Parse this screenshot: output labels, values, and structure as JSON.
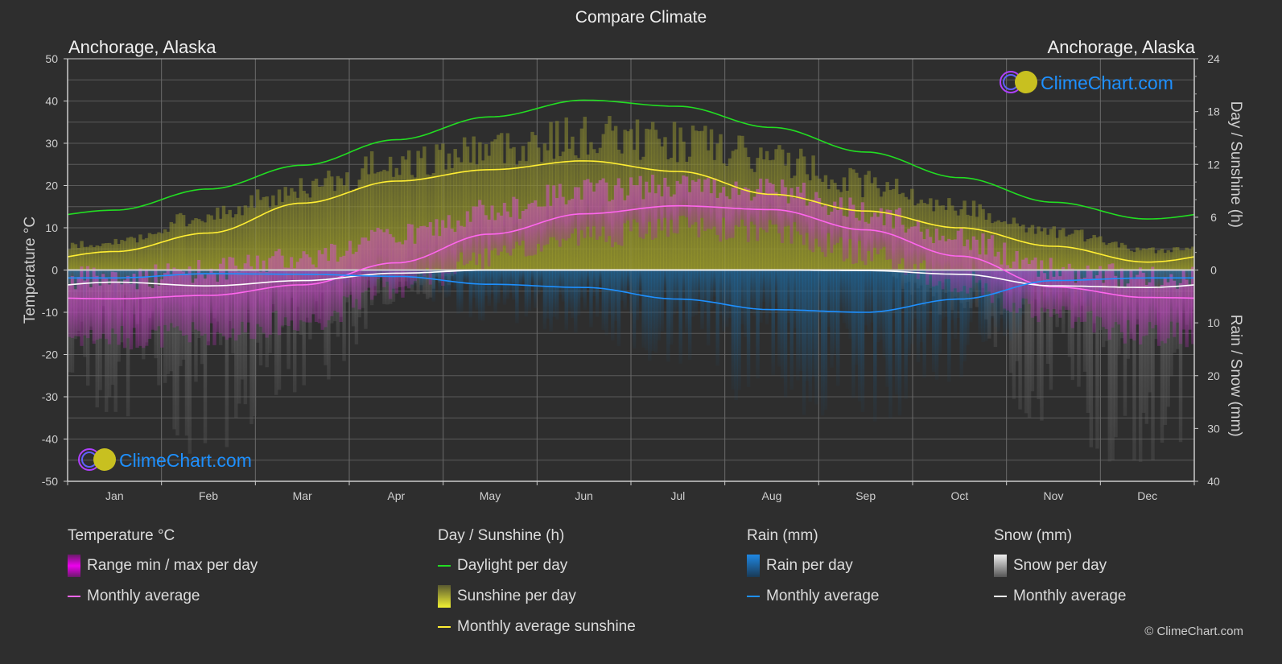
{
  "header": {
    "title": "Compare Climate",
    "location_left": "Anchorage, Alaska",
    "location_right": "Anchorage, Alaska"
  },
  "watermark": {
    "text": "ClimeChart.com"
  },
  "copyright": "© ClimeChart.com",
  "colors": {
    "background": "#2e2e2e",
    "grid": "#5a5a5a",
    "daylight": "#22dd22",
    "sunshine_fill": "#9a9a2a",
    "sunshine_avg": "#ffee33",
    "temp_range": "#cc44cc",
    "temp_avg": "#ff66ee",
    "rain_fill": "#1f5f8f",
    "rain_avg": "#1e90ff",
    "snow_fill": "#888888",
    "snow_avg": "#ffffff",
    "watermark_text": "#1e90ff"
  },
  "legend": {
    "groups": [
      {
        "title": "Temperature °C",
        "items": [
          {
            "label": "Range min / max per day",
            "kind": "bar",
            "color": "#ee00ee"
          },
          {
            "label": "Monthly average",
            "kind": "line",
            "color": "#ff66ee"
          }
        ]
      },
      {
        "title": "Day / Sunshine (h)",
        "items": [
          {
            "label": "Daylight per day",
            "kind": "line",
            "color": "#22dd22"
          },
          {
            "label": "Sunshine per day",
            "kind": "bar",
            "color": "#e6e633"
          },
          {
            "label": "Monthly average sunshine",
            "kind": "line",
            "color": "#ffee33"
          }
        ]
      },
      {
        "title": "Rain (mm)",
        "items": [
          {
            "label": "Rain per day",
            "kind": "bar",
            "color": "#1e88e5"
          },
          {
            "label": "Monthly average",
            "kind": "line",
            "color": "#1e90ff"
          }
        ]
      },
      {
        "title": "Snow (mm)",
        "items": [
          {
            "label": "Snow per day",
            "kind": "bar",
            "color": "#dddddd"
          },
          {
            "label": "Monthly average",
            "kind": "line",
            "color": "#ffffff"
          }
        ]
      }
    ]
  },
  "chart_data": {
    "type": "line",
    "title": "Compare Climate",
    "categories": [
      "Jan",
      "Feb",
      "Mar",
      "Apr",
      "May",
      "Jun",
      "Jul",
      "Aug",
      "Sep",
      "Oct",
      "Nov",
      "Dec"
    ],
    "axes": {
      "left": {
        "label": "Temperature °C",
        "range": [
          -50,
          50
        ],
        "ticks": [
          50,
          40,
          30,
          20,
          10,
          0,
          -10,
          -20,
          -30,
          -40,
          -50
        ]
      },
      "right_top": {
        "label": "Day / Sunshine (h)",
        "range": [
          0,
          24
        ],
        "ticks": [
          24,
          18,
          12,
          6,
          0
        ]
      },
      "right_bottom": {
        "label": "Rain / Snow (mm)",
        "range": [
          0,
          40
        ],
        "ticks": [
          10,
          20,
          30,
          40
        ],
        "inverted": true
      }
    },
    "grid": true,
    "series": [
      {
        "name": "Daylight per day",
        "axis": "right_top",
        "unit": "h",
        "values": [
          6.8,
          9.2,
          11.9,
          14.8,
          17.4,
          19.3,
          18.6,
          16.2,
          13.4,
          10.5,
          7.7,
          5.8
        ]
      },
      {
        "name": "Sunshine per day (max band)",
        "axis": "right_top",
        "unit": "h",
        "values": [
          3.5,
          7.0,
          10.5,
          13.5,
          15.5,
          16.8,
          16.3,
          14.0,
          11.0,
          7.8,
          4.8,
          2.5
        ]
      },
      {
        "name": "Monthly average sunshine",
        "axis": "right_top",
        "unit": "h",
        "values": [
          2.1,
          4.2,
          7.6,
          10.1,
          11.4,
          12.4,
          11.2,
          8.6,
          6.7,
          4.8,
          2.7,
          0.9
        ]
      },
      {
        "name": "Temperature max (range)",
        "axis": "left",
        "unit": "°C",
        "values": [
          -2,
          0,
          3,
          8,
          14,
          19,
          20,
          19,
          14,
          7,
          0,
          -2
        ]
      },
      {
        "name": "Temperature min (range)",
        "axis": "left",
        "unit": "°C",
        "values": [
          -16,
          -15,
          -12,
          -4,
          3,
          8,
          10,
          9,
          4,
          -3,
          -11,
          -15
        ]
      },
      {
        "name": "Temperature monthly average",
        "axis": "left",
        "unit": "°C",
        "values": [
          -6.8,
          -6.0,
          -3.5,
          1.7,
          8.5,
          13.3,
          15.2,
          14.3,
          9.5,
          3.3,
          -4.0,
          -6.5
        ]
      },
      {
        "name": "Rain monthly average",
        "axis": "right_bottom",
        "unit": "mm",
        "values": [
          1.5,
          0.7,
          0.8,
          1.2,
          2.7,
          3.3,
          5.5,
          7.5,
          8.0,
          5.5,
          2.0,
          1.5
        ]
      },
      {
        "name": "Snow monthly average",
        "axis": "right_bottom",
        "unit": "mm",
        "values": [
          2.3,
          3.0,
          2.0,
          0.6,
          0.0,
          0.0,
          0.0,
          0.0,
          0.1,
          0.8,
          3.0,
          3.3
        ]
      }
    ],
    "legend_position": "bottom"
  }
}
